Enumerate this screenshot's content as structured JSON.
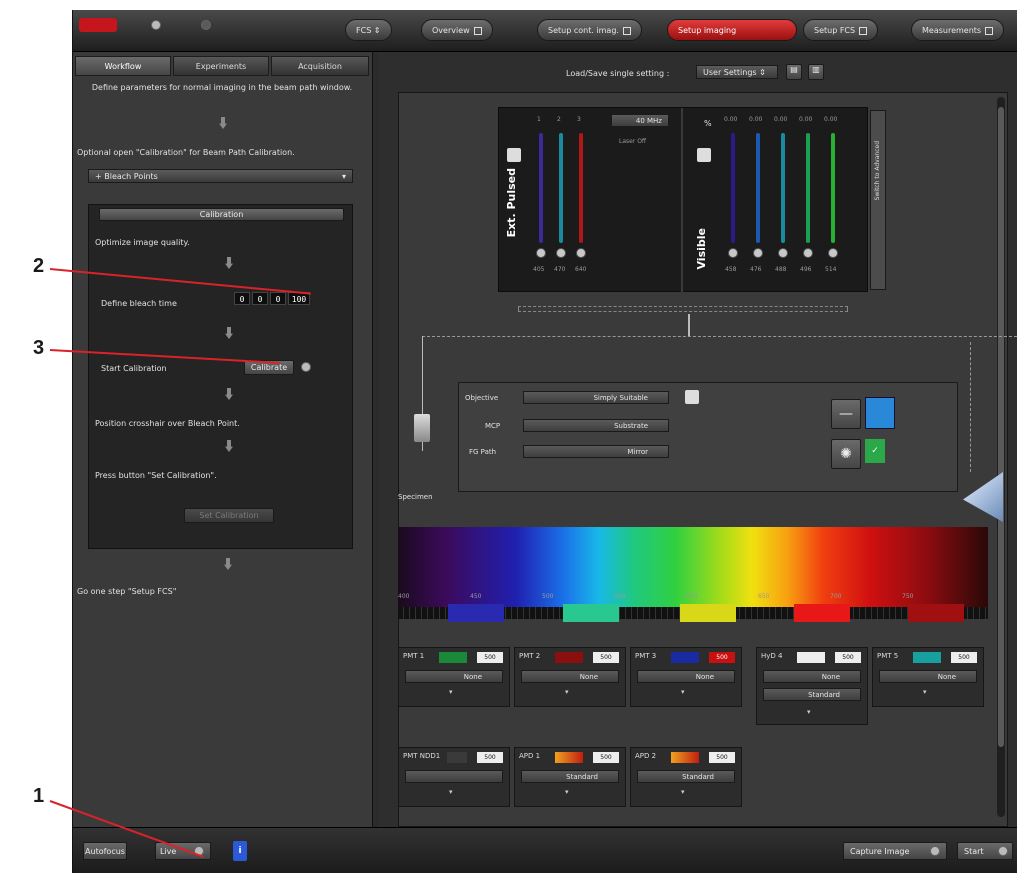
{
  "topbar": {
    "fcs_label": "FCS",
    "tabs": [
      {
        "label": "Overview"
      },
      {
        "label": "Setup cont. imag."
      },
      {
        "label": "Setup imaging"
      },
      {
        "label": "Setup FCS"
      },
      {
        "label": "Measurements"
      }
    ]
  },
  "left": {
    "tabs": [
      "Workflow",
      "Experiments",
      "Acquisition"
    ],
    "define_params_text": "Define parameters for normal imaging in the beam path window.",
    "optional_text": "Optional open \"Calibration\" for Beam Path Calibration.",
    "bleach_points": "Bleach Points",
    "calibration_header": "Calibration",
    "optimize_text": "Optimize image quality.",
    "define_bleach_text": "Define bleach time",
    "bleach_digits": [
      "0",
      "0",
      "0",
      "100"
    ],
    "start_calibration_text": "Start Calibration",
    "calibrate_button": "Calibrate",
    "position_text": "Position crosshair over Bleach Point.",
    "press_text": "Press button \"Set Calibration\".",
    "set_calibration_button": "Set Calibration",
    "next_step_text": "Go one step \"Setup FCS\""
  },
  "right": {
    "load_save_label": "Load/Save single setting :",
    "load_save_value": "User Settings",
    "laser_left_label": "Ext. Pulsed",
    "laser_left_nums": [
      "1",
      "2",
      "3"
    ],
    "laser_left_rate": "40 MHz",
    "laser_left_status": "Laser Off",
    "laser_left_waves": [
      "405",
      "470",
      "640"
    ],
    "laser_right_label": "Visible",
    "laser_right_percent": "%",
    "laser_right_values": [
      "0.00",
      "0.00",
      "0.00",
      "0.00",
      "0.00"
    ],
    "laser_right_waves": [
      "458",
      "476",
      "488",
      "496",
      "514"
    ],
    "side_text": "Switch to Advanced",
    "objective_label": "Objective",
    "objective_value": "Simply",
    "objective_value2": "Suitable",
    "mcp_label": "MCP",
    "mcp_value": "Substrate",
    "fg_path_label": "FG Path",
    "fg_path_value": "Mirror",
    "specimen_label": "Specimen",
    "scale_ticks": [
      "400",
      "450",
      "500",
      "550",
      "600",
      "650",
      "700",
      "750"
    ],
    "detectors_row1": [
      {
        "label": "PMT 1",
        "value": "500",
        "select": "None"
      },
      {
        "label": "PMT 2",
        "value": "500",
        "select": "None"
      },
      {
        "label": "PMT 3",
        "value": "500",
        "select": "None"
      },
      {
        "label": "HyD 4",
        "value": "500",
        "select": "None",
        "select2": "Standard"
      },
      {
        "label": "PMT 5",
        "value": "500",
        "select": "None"
      }
    ],
    "detectors_row2": [
      {
        "label": "PMT NDD1",
        "value": "500"
      },
      {
        "label": "APD 1",
        "value": "500",
        "select": "Standard"
      },
      {
        "label": "APD 2",
        "value": "500",
        "select": "Standard"
      }
    ]
  },
  "bottom": {
    "left_button": "Autofocus",
    "live_button": "Live",
    "capture_button": "Capture Image",
    "start_button": "Start"
  },
  "annotations": [
    "1",
    "2",
    "3"
  ]
}
